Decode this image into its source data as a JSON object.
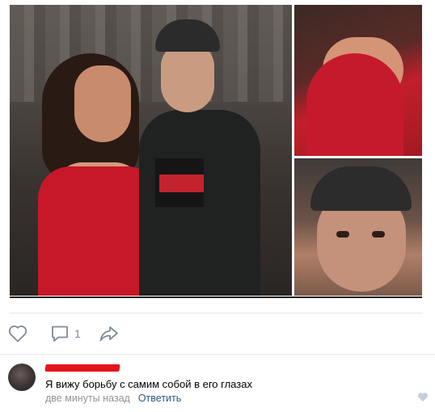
{
  "post": {
    "images": [
      {
        "name": "main-photo",
        "description": ""
      },
      {
        "name": "zoom-top-right"
      },
      {
        "name": "zoom-bottom-right"
      }
    ],
    "actions": {
      "like_count": "",
      "comment_count": "1",
      "share_count": ""
    }
  },
  "comment": {
    "author_redacted": true,
    "text": "Я вижу борьбу с самим собой в его глазах",
    "time": "две минуты назад",
    "reply_label": "Ответить"
  },
  "colors": {
    "link": "#2a5885",
    "muted": "#939393",
    "icon": "#828a99",
    "redaction": "#e3141c"
  },
  "icons": [
    "heart-icon",
    "comment-icon",
    "share-icon",
    "comment-like-icon"
  ]
}
